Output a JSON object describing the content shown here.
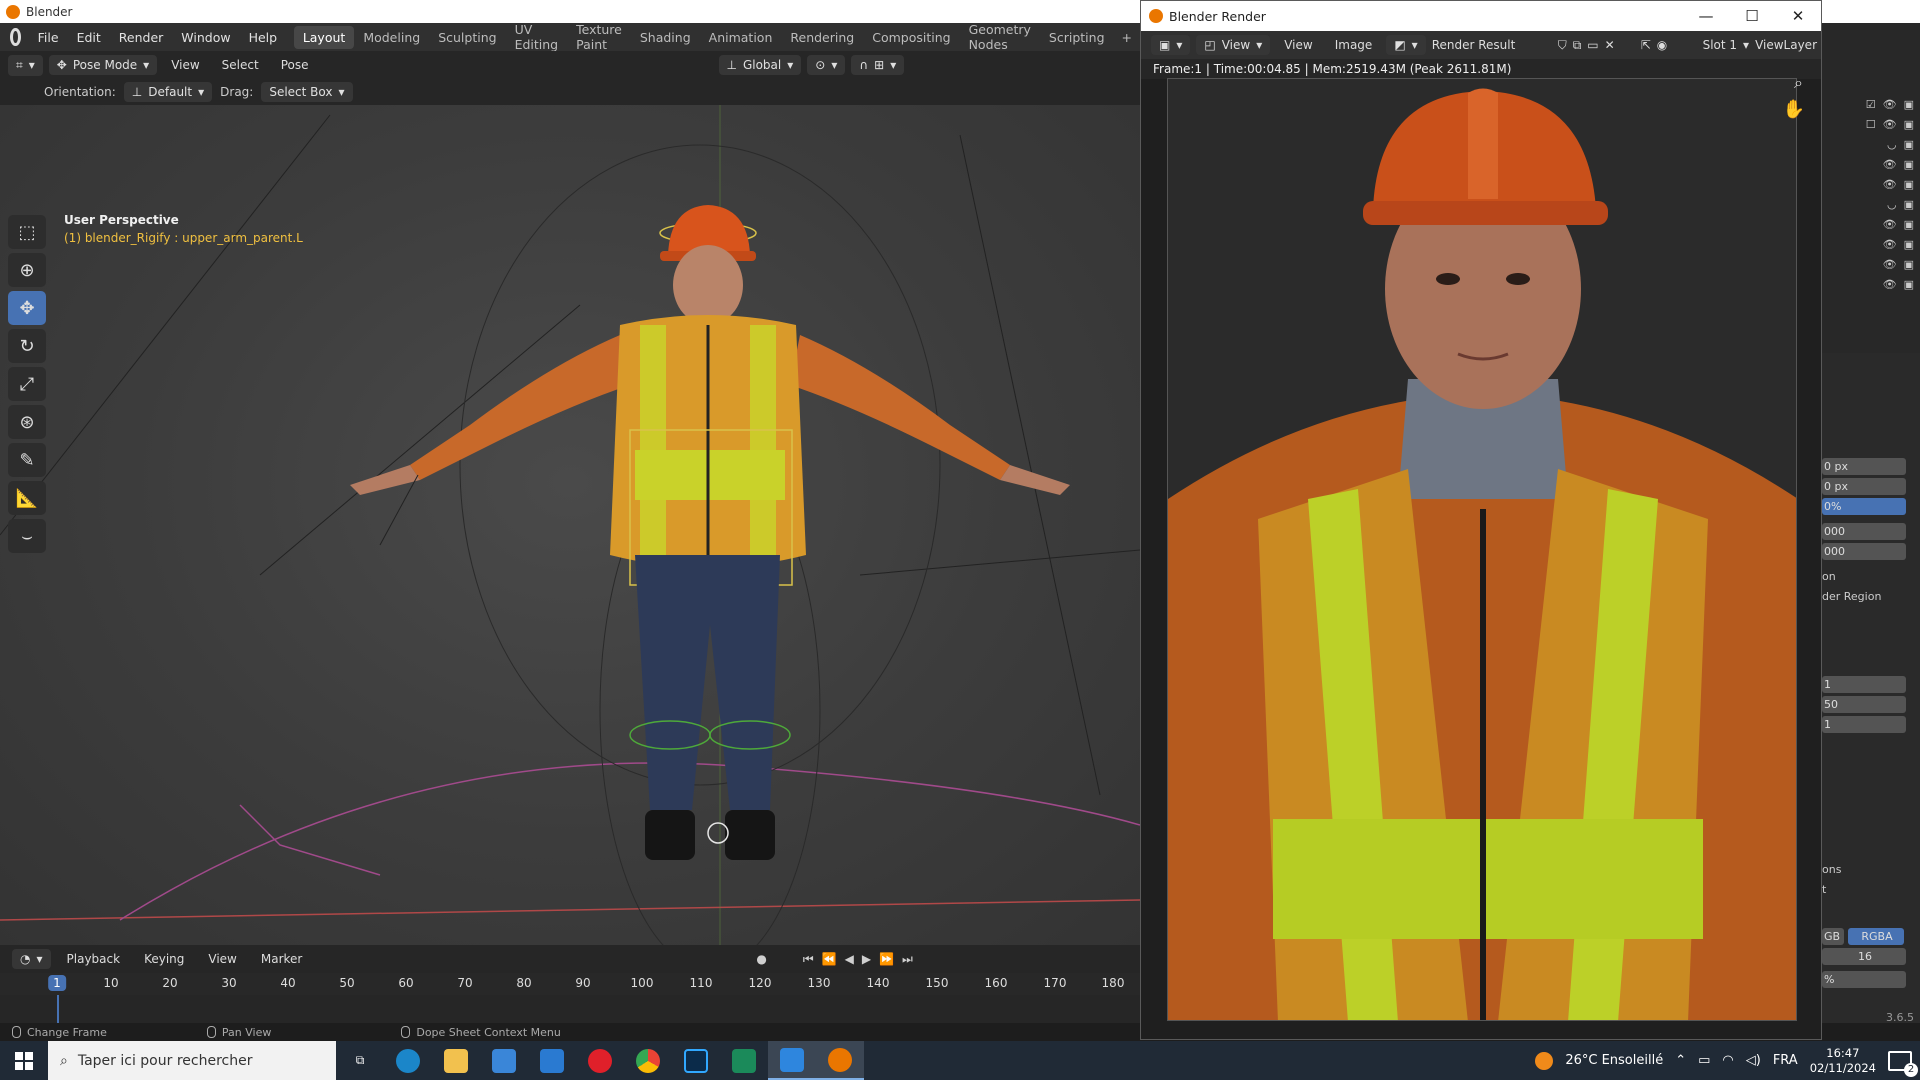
{
  "window": {
    "title": "Blender"
  },
  "menu": {
    "items": [
      "File",
      "Edit",
      "Render",
      "Window",
      "Help"
    ],
    "workspaces": [
      "Layout",
      "Modeling",
      "Sculpting",
      "UV Editing",
      "Texture Paint",
      "Shading",
      "Animation",
      "Rendering",
      "Compositing",
      "Geometry Nodes",
      "Scripting"
    ],
    "active_workspace": "Layout",
    "add": "+"
  },
  "viewport_header": {
    "mode": "Pose Mode",
    "view": "View",
    "select": "Select",
    "pose": "Pose",
    "transform": "Global"
  },
  "tool_header": {
    "orientation_label": "Orientation:",
    "orientation_value": "Default",
    "drag_label": "Drag:",
    "drag_value": "Select Box"
  },
  "viewport": {
    "perspective": "User Perspective",
    "object": "(1) blender_Rigify : upper_arm_parent.L"
  },
  "timeline": {
    "menus": [
      "Playback",
      "Keying",
      "View",
      "Marker"
    ],
    "current_frame": "1",
    "ticks": [
      "10",
      "20",
      "30",
      "40",
      "50",
      "60",
      "70",
      "80",
      "90",
      "100",
      "110",
      "120",
      "130",
      "140",
      "150",
      "160",
      "170",
      "180"
    ]
  },
  "statusbar": {
    "left": "Change Frame",
    "middle": "Pan View",
    "right": "Dope Sheet Context Menu",
    "version": "3.6.5"
  },
  "render_window": {
    "title": "Blender Render",
    "menus": [
      "View",
      "View",
      "Image"
    ],
    "image_name": "Render Result",
    "slot": "Slot 1",
    "view_layer": "ViewLayer",
    "info": "Frame:1 | Time:00:04.85 | Mem:2519.43M (Peak 2611.81M)"
  },
  "properties": {
    "fields": [
      "0 px",
      "0 px",
      "0%",
      "000",
      "000"
    ],
    "labels": [
      "on",
      "der Region"
    ],
    "fields2": [
      "1",
      "50",
      "1"
    ],
    "labels2": [
      "ons",
      "t"
    ],
    "color_modes": [
      "GB",
      "RGBA"
    ],
    "depth": "16",
    "percent": "%"
  },
  "taskbar": {
    "search_placeholder": "Taper ici pour rechercher",
    "weather": "26°C Ensoleillé",
    "language": "FRA",
    "time": "16:47",
    "date": "02/11/2024",
    "notifications": "2"
  },
  "colors": {
    "accent": "#4772b3",
    "blender_orange": "#ea7600"
  }
}
